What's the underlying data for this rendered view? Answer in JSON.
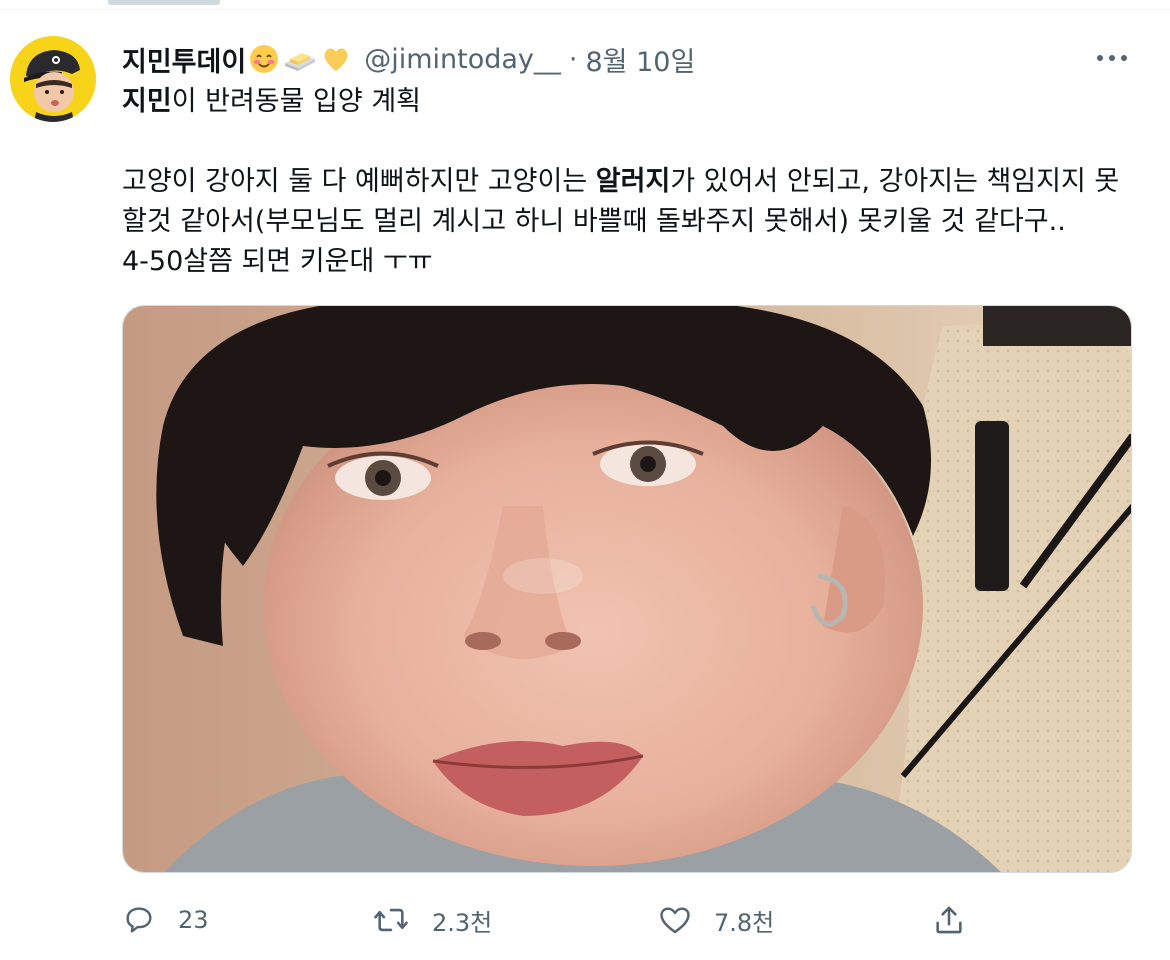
{
  "tweet": {
    "display_name": "지민투데이",
    "name_emojis": [
      "smiling-face-with-blush-icon",
      "butter-icon",
      "yellow-heart-icon"
    ],
    "handle": "@jimintoday__",
    "separator": "·",
    "date": "8월 10일",
    "title_bold": "지민",
    "title_rest": "이 반려동물 입양 계획",
    "body_part1": "고양이 강아지 둘 다 예뻐하지만 고양이는 ",
    "body_bold": "알러지",
    "body_part2": "가 있어서 안되고, 강아지는 책임지지 못할것 같아서(부모님도 멀리 계시고 하니 바쁠때 돌봐주지 못해서) 못키울 것 같다구..",
    "body_line3": "4-50살쯤 되면 키운대 ㅜㅠ",
    "media_description": "photo",
    "more_icon": "more-horizontal-icon"
  },
  "actions": {
    "reply": {
      "icon": "reply-icon",
      "count": "23"
    },
    "retweet": {
      "icon": "retweet-icon",
      "count": "2.3천"
    },
    "like": {
      "icon": "heart-icon",
      "count": "7.8천"
    },
    "share": {
      "icon": "share-icon"
    }
  },
  "colors": {
    "text_primary": "#0f1419",
    "text_secondary": "#536471",
    "avatar_bg": "#f7d41a",
    "border": "#cfd9de"
  }
}
